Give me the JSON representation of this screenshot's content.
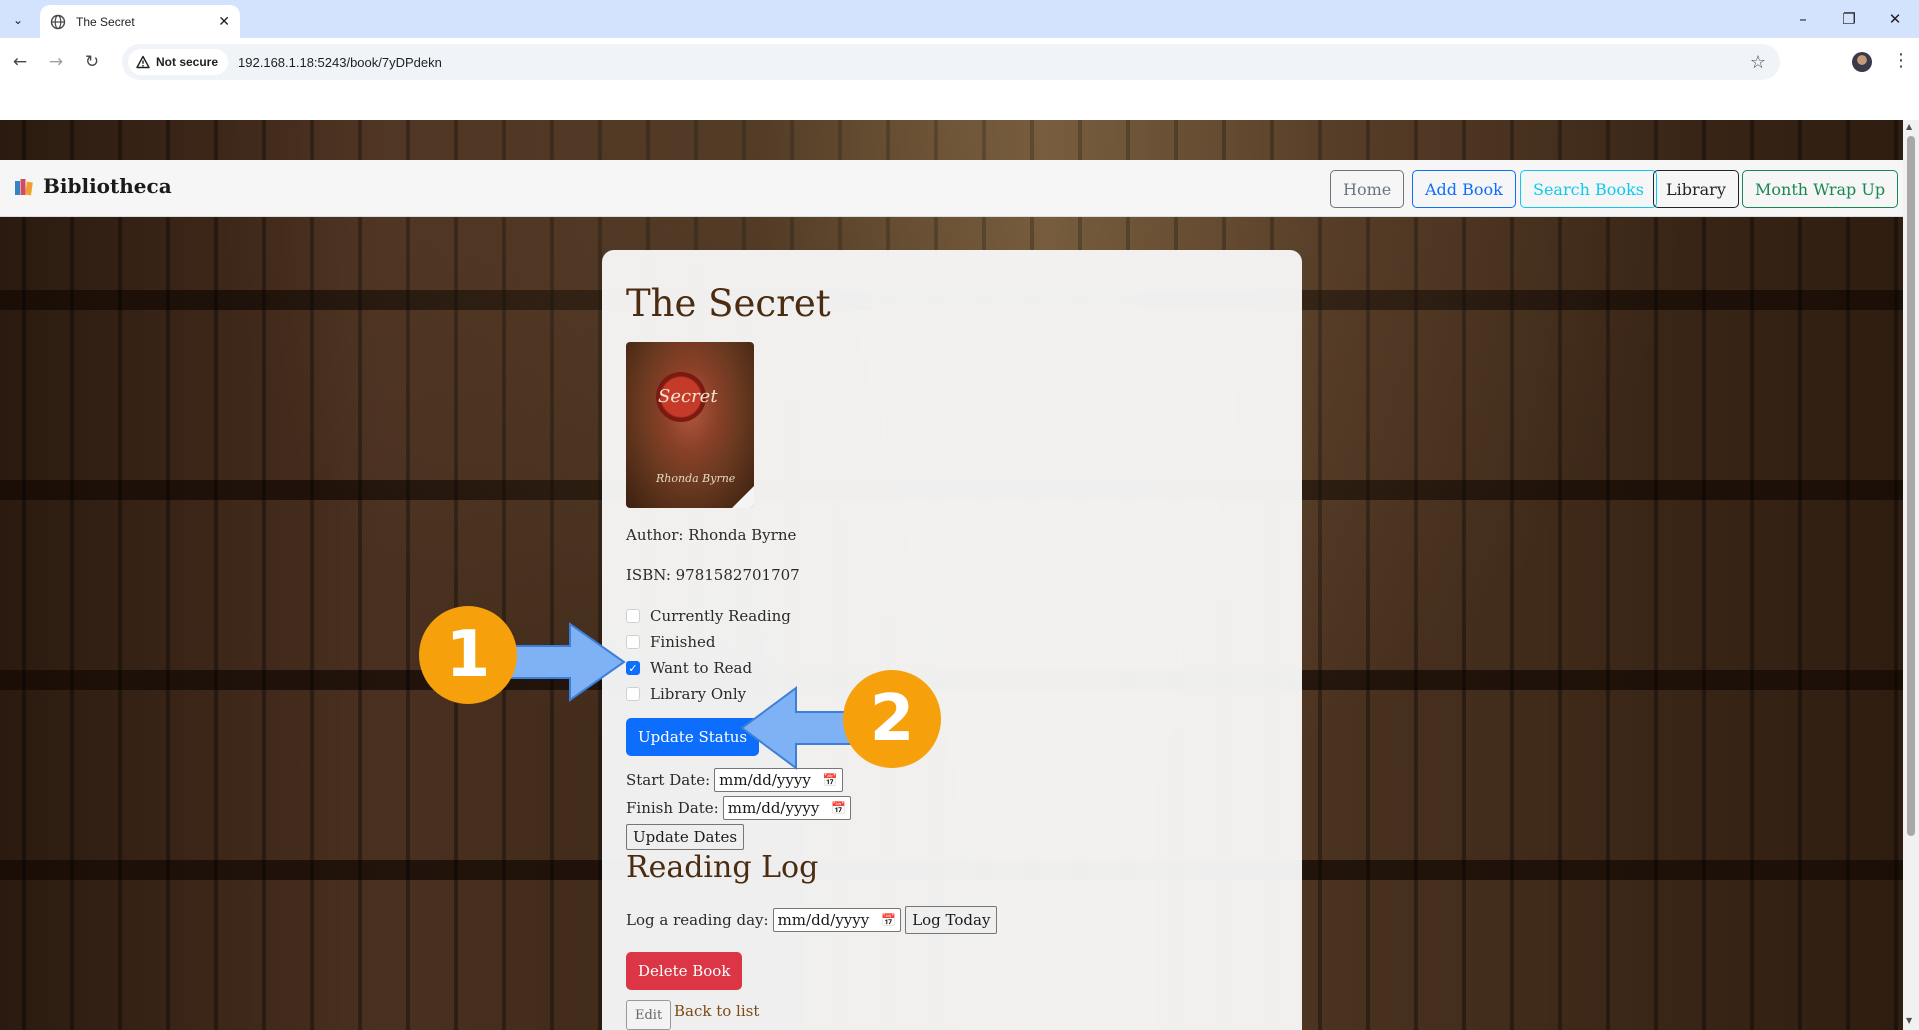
{
  "browser": {
    "tab_title": "The Secret",
    "security_label": "Not secure",
    "url": "192.168.1.18:5243/book/7yDPdekn"
  },
  "navbar": {
    "brand": "Bibliotheca",
    "links": [
      {
        "label": "Home",
        "color": "#6c757d"
      },
      {
        "label": "Add Book",
        "color": "#0d6efd"
      },
      {
        "label": "Search Books",
        "color": "#0dcaf0"
      },
      {
        "label": "Library",
        "color": "#212529"
      },
      {
        "label": "Month Wrap Up",
        "color": "#198754"
      }
    ]
  },
  "book": {
    "title": "The Secret",
    "cover_title": "Secret",
    "cover_author": "Rhonda Byrne",
    "author_line": "Author: Rhonda Byrne",
    "isbn_line": "ISBN: 9781582701707"
  },
  "status": {
    "options": [
      {
        "label": "Currently Reading",
        "checked": false
      },
      {
        "label": "Finished",
        "checked": false
      },
      {
        "label": "Want to Read",
        "checked": true
      },
      {
        "label": "Library Only",
        "checked": false
      }
    ],
    "update_label": "Update Status"
  },
  "dates": {
    "start_label": "Start Date:",
    "finish_label": "Finish Date:",
    "placeholder": "mm/dd/yyyy",
    "update_label": "Update Dates"
  },
  "reading_log": {
    "title": "Reading Log",
    "log_label": "Log a reading day:",
    "placeholder": "mm/dd/yyyy",
    "log_today_label": "Log Today"
  },
  "actions": {
    "delete_label": "Delete Book",
    "edit_label": "Edit",
    "back_label": "Back to list"
  },
  "annotations": {
    "step1": "1",
    "step2": "2"
  },
  "colors": {
    "accent": "#0d6efd",
    "danger": "#dc3545",
    "heading": "#4a2c10",
    "badge": "#f6a10c",
    "arrow": "#7fb2f5"
  }
}
